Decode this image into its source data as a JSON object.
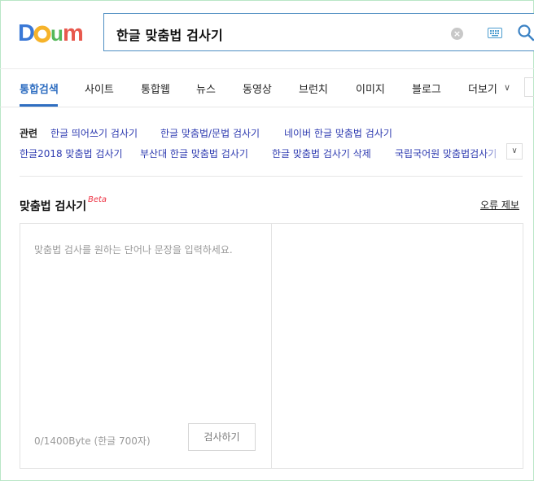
{
  "header": {
    "logo_text": "Daum",
    "search_query": "한글 맞춤법 검사기",
    "clear_glyph": "×",
    "icons": {
      "clear": "clear-icon",
      "keyboard": "keyboard-icon",
      "search": "search-icon"
    },
    "colors": {
      "border": "#4f8ec2",
      "search_icon": "#3b82c4"
    }
  },
  "tabs": {
    "items": [
      {
        "label": "통합검색",
        "active": true
      },
      {
        "label": "사이트",
        "active": false
      },
      {
        "label": "통합웹",
        "active": false
      },
      {
        "label": "뉴스",
        "active": false
      },
      {
        "label": "동영상",
        "active": false
      },
      {
        "label": "브런치",
        "active": false
      },
      {
        "label": "이미지",
        "active": false
      },
      {
        "label": "블로그",
        "active": false
      },
      {
        "label": "더보기",
        "active": false
      }
    ],
    "more_icon": "chevron-down-icon",
    "active_color": "#2f6ec1"
  },
  "related": {
    "label": "관련",
    "items": [
      "한글 띄어쓰기 검사기",
      "한글 맞춤법/문법 검사기",
      "네이버 한글 맞춤법 검사기",
      "한글2018 맞춤법 검사기",
      "부산대 한글 맞춤법 검사기",
      "한글 맞춤법 검사기 삭제",
      "국립국어원 맞춤법검사기"
    ],
    "toggle_icon": "chevron-down-icon",
    "link_color": "#2e3bb0"
  },
  "spellcheck": {
    "title": "맞춤법 검사기",
    "beta": "Beta",
    "report": "오류 제보",
    "placeholder": "맞춤법 검사를 원하는 단어나 문장을 입력하세요.",
    "count": "0/1400Byte (한글 700자)",
    "button": "검사하기"
  }
}
